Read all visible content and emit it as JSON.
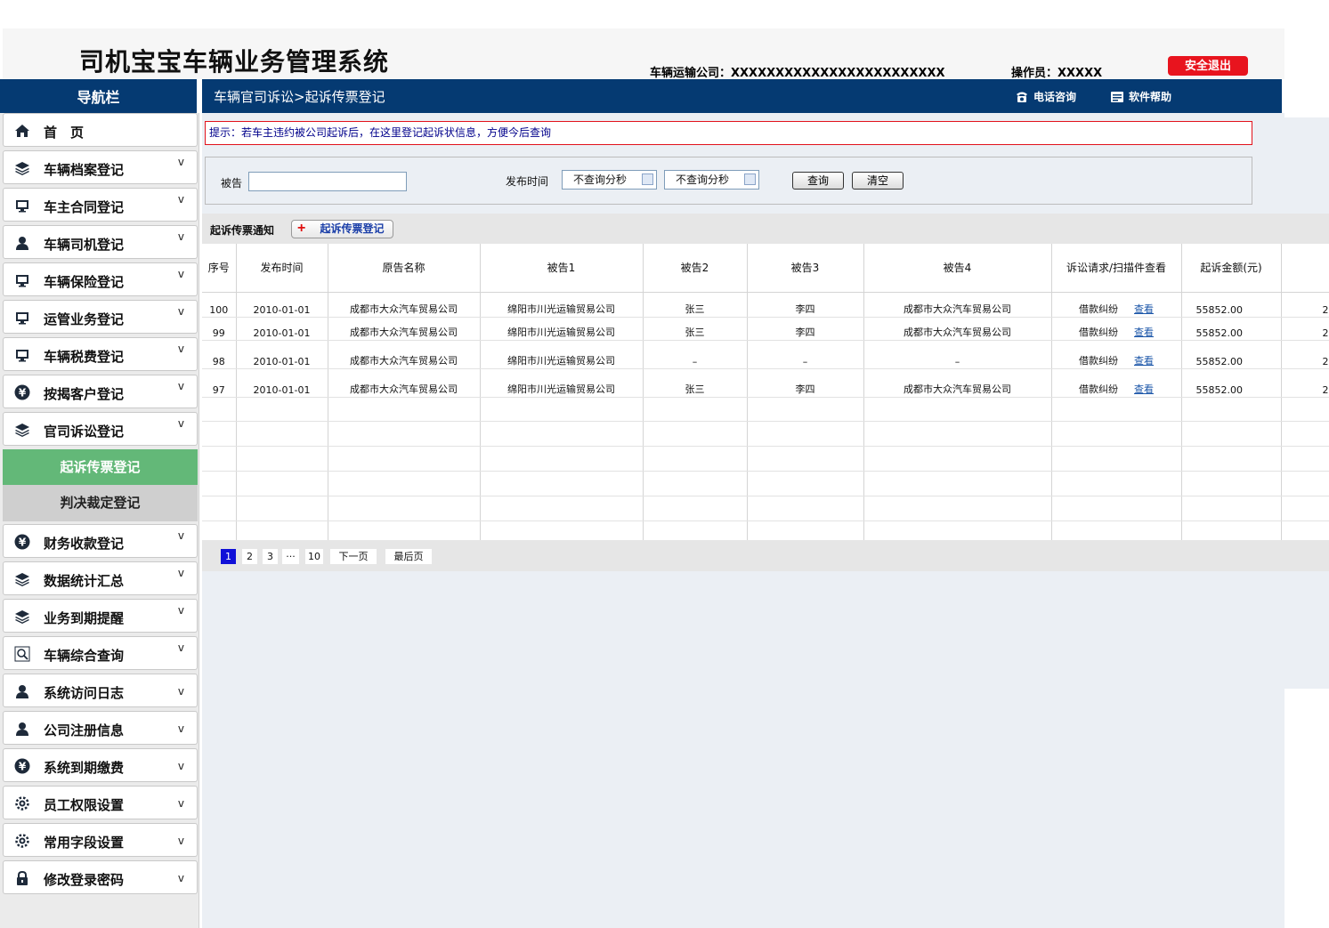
{
  "header": {
    "title": "司机宝宝车辆业务管理系统",
    "company": "车辆运输公司：XXXXXXXXXXXXXXXXXXXXXXXX",
    "operator": "操作员：XXXXX",
    "logout": "安全退出"
  },
  "nav": {
    "title": "导航栏"
  },
  "topbar": {
    "breadcrumb": "车辆官司诉讼>起诉传票登记",
    "phone": "电话咨询",
    "help": "软件帮助"
  },
  "sidebar": {
    "items": [
      {
        "label": "首　页",
        "icon": "home-icon",
        "chev": ""
      },
      {
        "label": "车辆档案登记",
        "icon": "layers-icon",
        "chev": "^"
      },
      {
        "label": "车主合同登记",
        "icon": "monitor-icon",
        "chev": "^"
      },
      {
        "label": "车辆司机登记",
        "icon": "user-icon",
        "chev": "^"
      },
      {
        "label": "车辆保险登记",
        "icon": "monitor-icon",
        "chev": "^"
      },
      {
        "label": "运管业务登记",
        "icon": "monitor-icon",
        "chev": "^"
      },
      {
        "label": "车辆税费登记",
        "icon": "monitor-icon",
        "chev": "^"
      },
      {
        "label": "按揭客户登记",
        "icon": "yen-icon",
        "chev": "^"
      },
      {
        "label": "官司诉讼登记",
        "icon": "layers-icon",
        "chev": "^"
      },
      {
        "label": "财务收款登记",
        "icon": "yen-icon",
        "chev": "^"
      },
      {
        "label": "数据统计汇总",
        "icon": "layers-icon",
        "chev": "^"
      },
      {
        "label": "业务到期提醒",
        "icon": "layers-icon",
        "chev": "^"
      },
      {
        "label": "车辆综合查询",
        "icon": "search-icon",
        "chev": "^"
      },
      {
        "label": "系统访问日志",
        "icon": "user-icon",
        "chev": "v"
      },
      {
        "label": "公司注册信息",
        "icon": "user-icon",
        "chev": "v"
      },
      {
        "label": "系统到期缴费",
        "icon": "yen-icon",
        "chev": "v"
      },
      {
        "label": "员工权限设置",
        "icon": "gear-icon",
        "chev": "v"
      },
      {
        "label": "常用字段设置",
        "icon": "gear-icon",
        "chev": "v"
      },
      {
        "label": "修改登录密码",
        "icon": "lock-icon",
        "chev": "v"
      }
    ],
    "submenu": {
      "active": "起诉传票登记",
      "other": "判决裁定登记"
    }
  },
  "tip": "提示：若车主违约被公司起诉后，在这里登记起诉状信息，方便今后查询",
  "search": {
    "defendant_label": "被告",
    "date_label": "发布时间",
    "date_start": "不查询分秒",
    "date_end": "不查询分秒",
    "query": "查询",
    "clear": "清空"
  },
  "list": {
    "title": "起诉传票通知",
    "add": "起诉传票登记",
    "columns": [
      "序号",
      "发布时间",
      "原告名称",
      "被告1",
      "被告2",
      "被告3",
      "被告4",
      "诉讼请求/扫描件查看",
      "起诉金额(元)",
      ""
    ],
    "rows": [
      {
        "no": "100",
        "date": "2010-01-01",
        "plaintiff": "成都市大众汽车贸易公司",
        "d1": "绵阳市川光运输贸易公司",
        "d2": "张三",
        "d3": "李四",
        "d4": "成都市大众汽车贸易公司",
        "claim": "借款纠纷",
        "view": "查看",
        "amount": "55852.00",
        "extra": "2"
      },
      {
        "no": "99",
        "date": "2010-01-01",
        "plaintiff": "成都市大众汽车贸易公司",
        "d1": "绵阳市川光运输贸易公司",
        "d2": "张三",
        "d3": "李四",
        "d4": "成都市大众汽车贸易公司",
        "claim": "借款纠纷",
        "view": "查看",
        "amount": "55852.00",
        "extra": "2"
      },
      {
        "no": "98",
        "date": "2010-01-01",
        "plaintiff": "成都市大众汽车贸易公司",
        "d1": "绵阳市川光运输贸易公司",
        "d2": "–",
        "d3": "–",
        "d4": "–",
        "claim": "借款纠纷",
        "view": "查看",
        "amount": "55852.00",
        "extra": "2"
      },
      {
        "no": "97",
        "date": "2010-01-01",
        "plaintiff": "成都市大众汽车贸易公司",
        "d1": "绵阳市川光运输贸易公司",
        "d2": "张三",
        "d3": "李四",
        "d4": "成都市大众汽车贸易公司",
        "claim": "借款纠纷",
        "view": "查看",
        "amount": "55852.00",
        "extra": "2"
      }
    ]
  },
  "pager": {
    "pages": [
      "1",
      "2",
      "3",
      "···",
      "10"
    ],
    "next": "下一页",
    "last": "最后页"
  },
  "colors": {
    "nav_blue": "#053a72",
    "active_green": "#63b878",
    "logout_red": "#e8141e",
    "tip_border": "#e2121b"
  }
}
